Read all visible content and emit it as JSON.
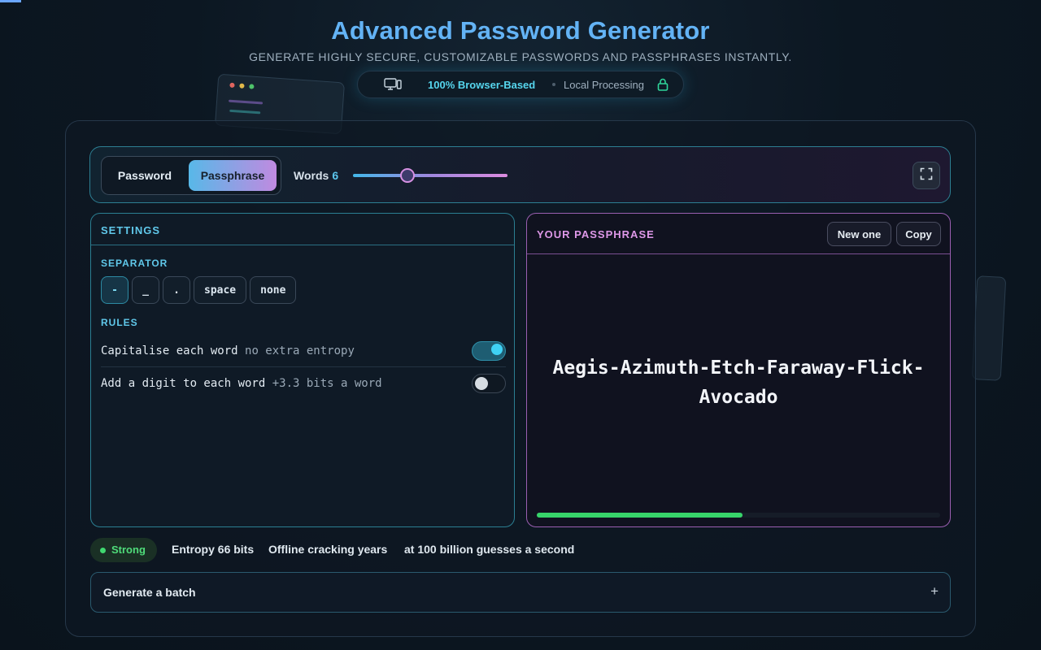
{
  "header": {
    "title": "Advanced Password Generator",
    "subtitle": "GENERATE HIGHLY SECURE, CUSTOMIZABLE PASSWORDS AND PASSPHRASES INSTANTLY.",
    "badge_primary": "100% Browser-Based",
    "badge_secondary": "Local Processing",
    "badge_icons": [
      "monitor-icon",
      "lock-icon"
    ]
  },
  "toolbar": {
    "mode_tabs": [
      {
        "label": "Password",
        "active": false
      },
      {
        "label": "Passphrase",
        "active": true
      }
    ],
    "words_label": "Words",
    "words_value": "6",
    "words_slider_fraction": 0.35,
    "expand_icon": "fullscreen-icon"
  },
  "settings": {
    "title": "SETTINGS",
    "separator_label": "SEPARATOR",
    "separators": [
      {
        "label": "-",
        "active": true
      },
      {
        "label": "_",
        "active": false
      },
      {
        "label": ".",
        "active": false
      },
      {
        "label": "space",
        "active": false
      },
      {
        "label": "none",
        "active": false
      }
    ],
    "rules_label": "RULES",
    "rules": [
      {
        "label": "Capitalise each word",
        "hint": "no extra entropy",
        "enabled": true
      },
      {
        "label": "Add a digit to each word",
        "hint": "+3.3 bits a word",
        "enabled": false
      }
    ]
  },
  "output": {
    "title": "YOUR PASSPHRASE",
    "new_label": "New one",
    "copy_label": "Copy",
    "passphrase": "Aegis-Azimuth-Etch-Faraway-Flick-Avocado",
    "strength_fraction": 0.51
  },
  "stats": {
    "strength_label": "Strong",
    "entropy_label": "Entropy",
    "entropy_value": "66 bits",
    "offline_label": "Offline cracking",
    "offline_value": "years",
    "rate_note": "at 100 billion guesses a second"
  },
  "batch": {
    "label": "Generate a batch",
    "toggle_symbol": "+"
  },
  "colors": {
    "title": "#63b3f5",
    "accent_cyan": "#5bc6ee",
    "accent_pink": "#de98e8",
    "strength_green": "#37d46a"
  }
}
